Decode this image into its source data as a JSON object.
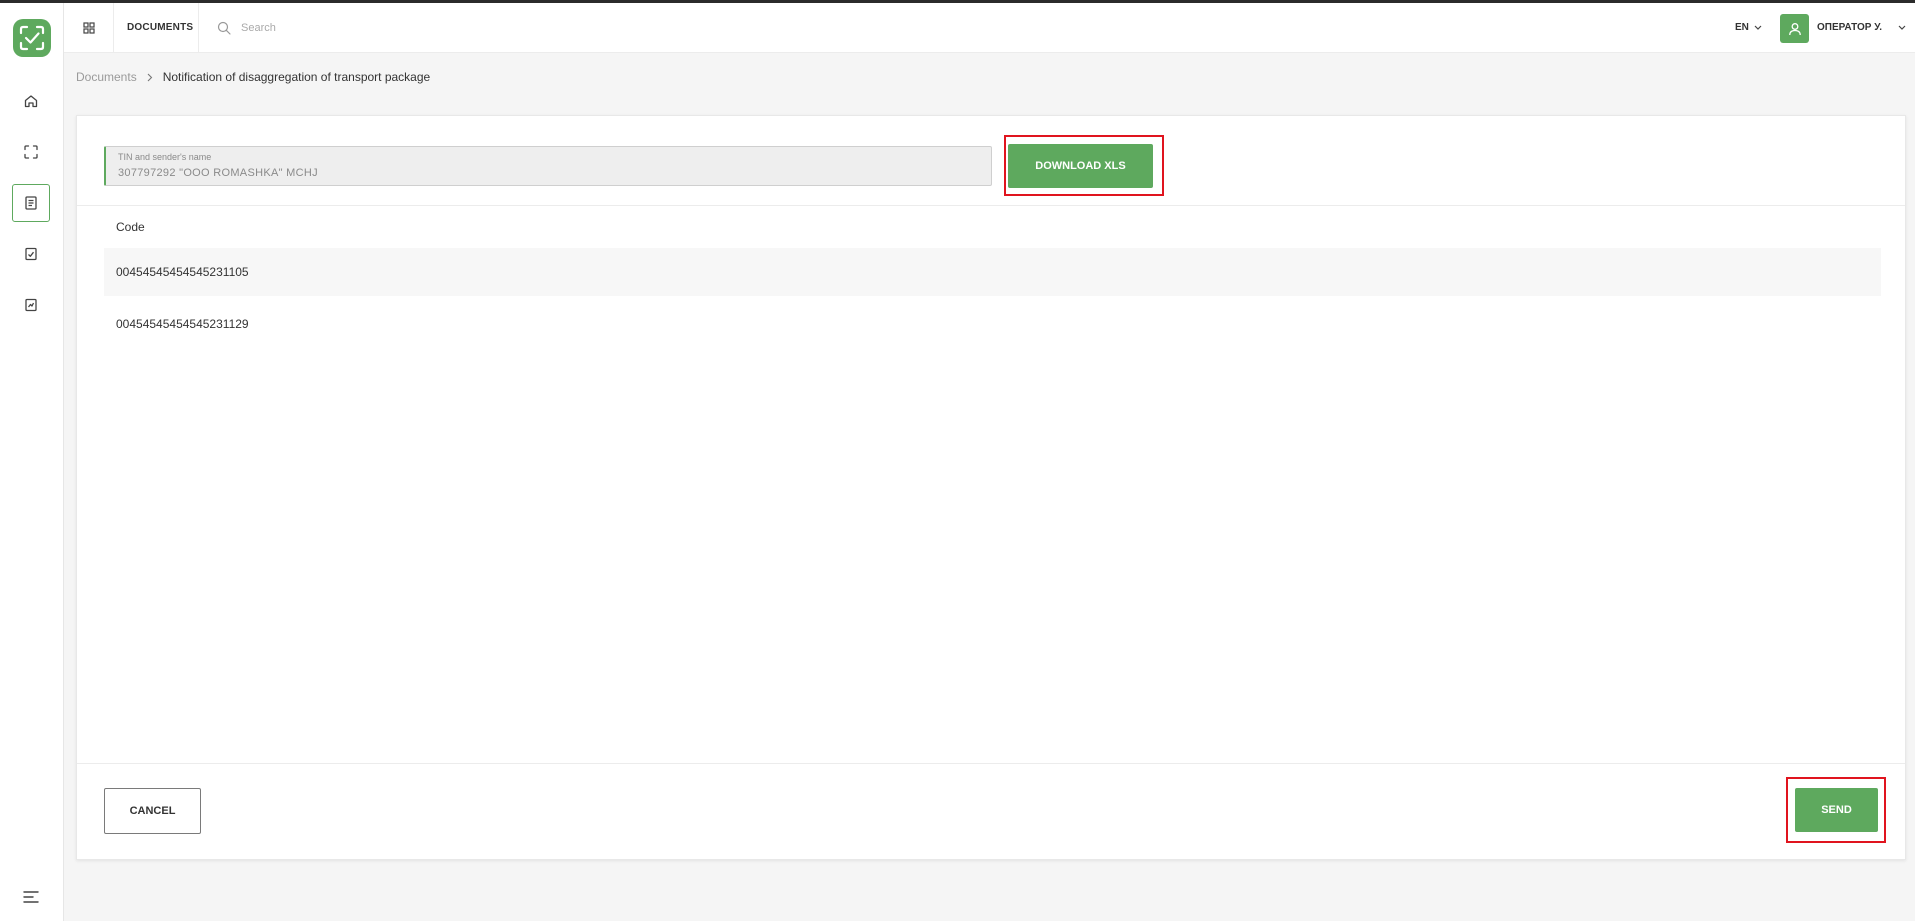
{
  "header": {
    "section_title": "DOCUMENTS",
    "search_placeholder": "Search",
    "language": "EN",
    "user_name": "ОПЕРАТОР У."
  },
  "sidebar": {
    "items": [
      {
        "icon": "home-icon"
      },
      {
        "icon": "scan-icon"
      },
      {
        "icon": "document-icon",
        "active": true
      },
      {
        "icon": "checklist-icon"
      },
      {
        "icon": "report-icon"
      }
    ]
  },
  "breadcrumb": {
    "parent": "Documents",
    "current": "Notification of disaggregation of transport package"
  },
  "form": {
    "sender_label": "TIN and sender's name",
    "sender_value": "307797292 \"OOO ROMASHKA\" MCHJ",
    "download_label": "DOWNLOAD XLS"
  },
  "table": {
    "column_header": "Code",
    "rows": [
      {
        "code": "00454545454545231105"
      },
      {
        "code": "00454545454545231129"
      }
    ]
  },
  "actions": {
    "cancel_label": "CANCEL",
    "send_label": "SEND"
  },
  "colors": {
    "accent": "#5ea95e",
    "highlight": "#e0141e"
  }
}
